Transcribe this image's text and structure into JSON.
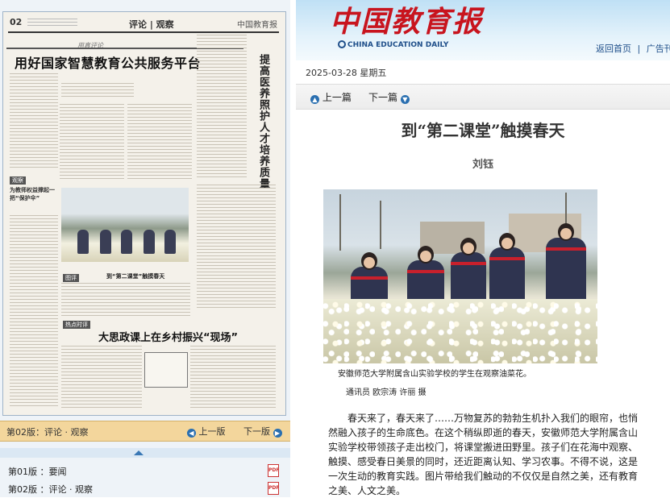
{
  "newspaper": {
    "page_number": "02",
    "section": "评论 | 观察",
    "masthead": "中国教育报",
    "column_tag": "用真评论",
    "main_headline": "用好国家智慧教育公共服务平台",
    "vertical_headline": "提高医养照护人才培养质量",
    "tag_1": "观察",
    "side_headline": "为教师权益撑起一把“保护伞”",
    "photo_caption": "到“第二课堂”触摸春天",
    "tag_2": "图评",
    "tag_3": "热点时评",
    "headline_2": "大思政课上在乡村振兴“现场”"
  },
  "edition_nav": {
    "current_edition": "第02版：评论 · 观察",
    "prev_label": "上一版",
    "next_label": "下一版"
  },
  "editions": [
    {
      "label": "第01版 ：要闻",
      "pdf": "PDF"
    },
    {
      "label": "第02版 ：评论 · 观察",
      "pdf": "PDF"
    }
  ],
  "site": {
    "brand": "中国教育报",
    "brand_en": "CHINA EDUCATION DAILY",
    "home_link": "返回首页",
    "separator": "|",
    "ad_link": "广告刊例"
  },
  "article": {
    "date": "2025-03-28 星期五",
    "prev_label": "上一篇",
    "next_label": "下一篇",
    "title": "到“第二课堂”触摸春天",
    "author": "刘钰",
    "photo_caption": "安徽师范大学附属含山实验学校的学生在观察油菜花。",
    "photo_credit": "通讯员 欧宗涛 许丽 摄",
    "body": "春天来了，春天来了……万物复苏的勃勃生机扑入我们的眼帘，也悄然融入孩子的生命底色。在这个稍纵即逝的春天，安徽师范大学附属含山实验学校带领孩子走出校门，将课堂搬进田野里。孩子们在花海中观察、触摸、感受春日美景的同时，还近距离认知、学习农事。不得不说，这是一次生动的教育实践。图片带给我们触动的不仅仅是自然之美，还有教育之美、人文之美。"
  },
  "colors": {
    "brand_red": "#c8141e",
    "link_blue": "#1f4f8a",
    "nav_orange": "#f3d69c"
  }
}
